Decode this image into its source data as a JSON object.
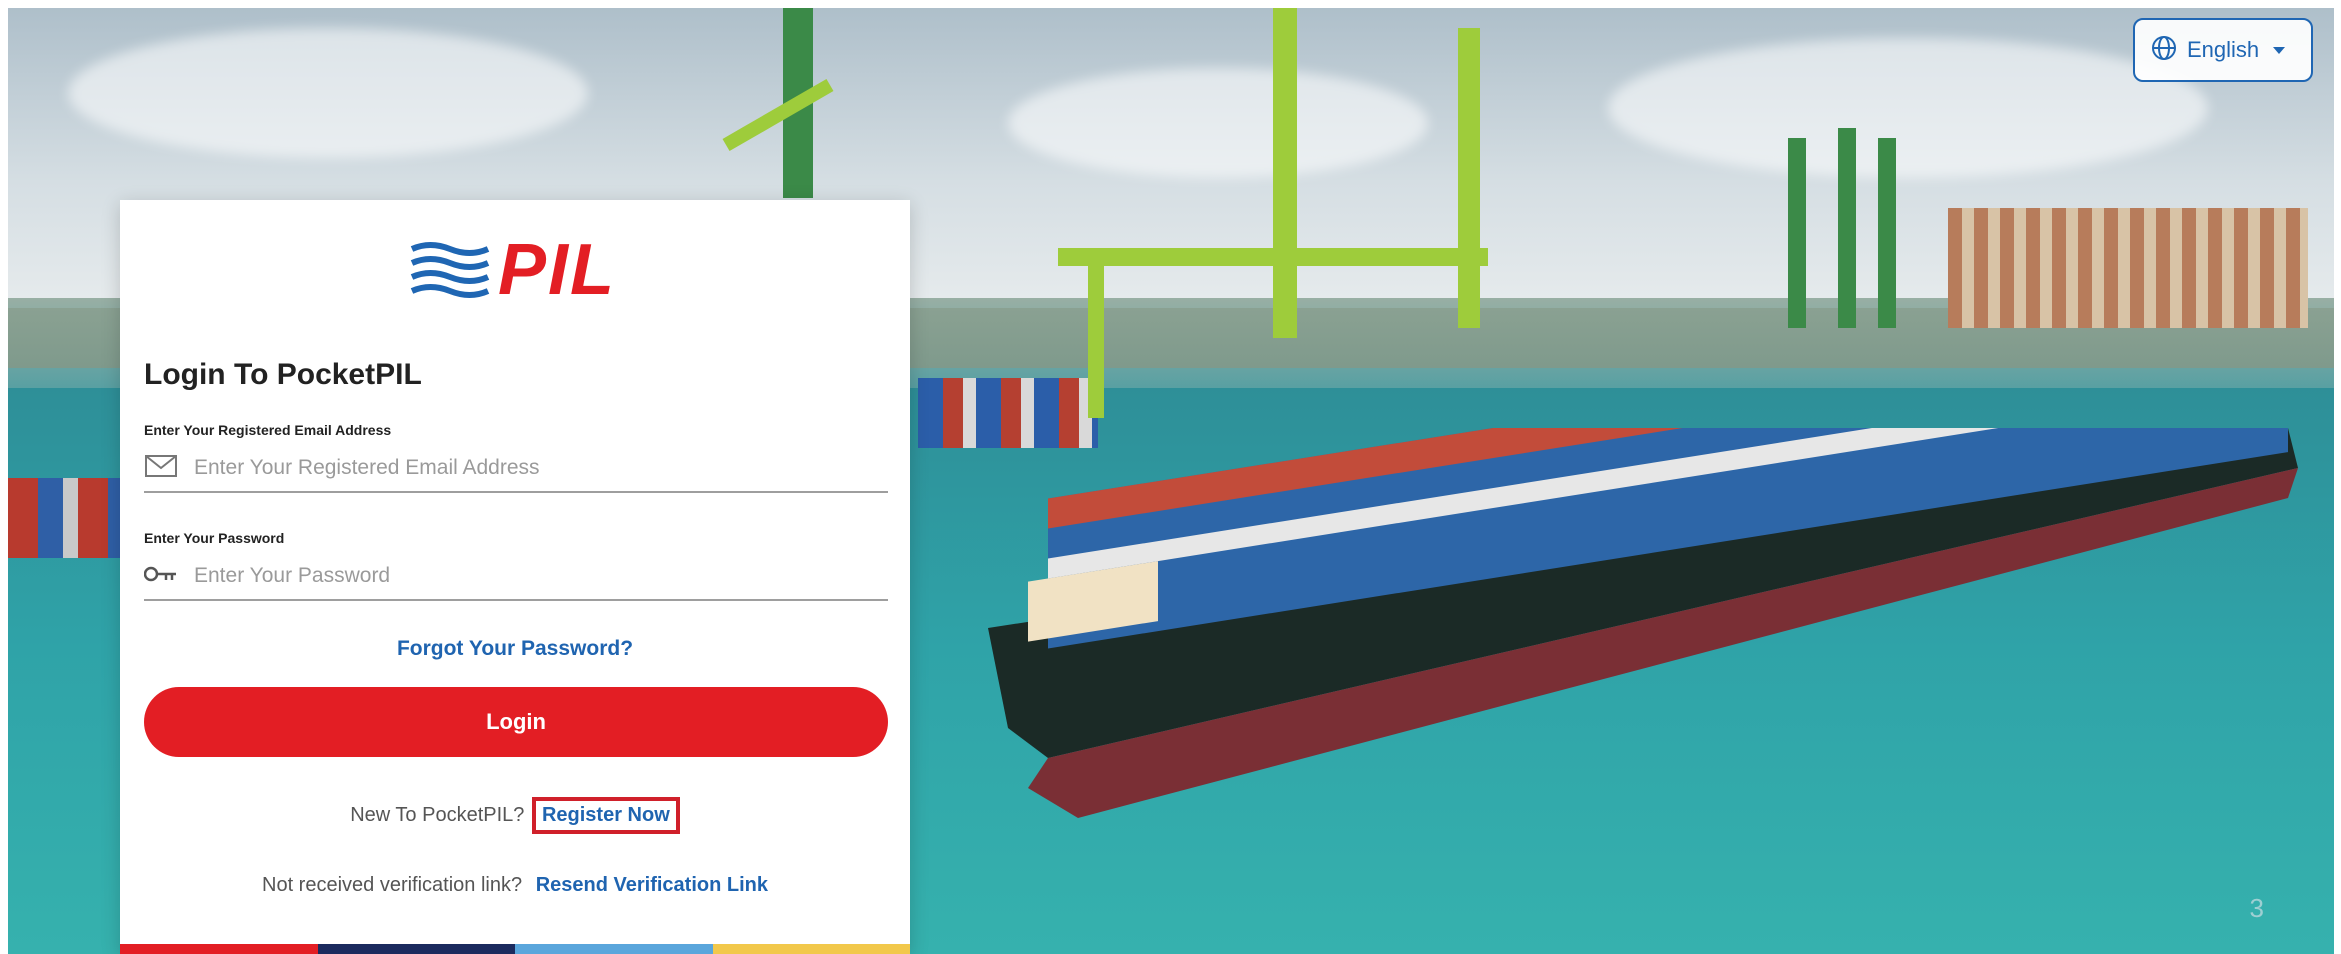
{
  "language_selector": {
    "label": "English",
    "icon": "globe-icon"
  },
  "card": {
    "logo_text": "PIL",
    "title": "Login To PocketPIL",
    "email": {
      "label": "Enter Your Registered Email Address",
      "placeholder": "Enter Your Registered Email Address",
      "value": "",
      "icon": "mail-icon"
    },
    "password": {
      "label": "Enter Your Password",
      "placeholder": "Enter Your Password",
      "value": "",
      "icon": "key-icon"
    },
    "forgot_password": "Forgot Your Password?",
    "login_button": "Login",
    "new_user_text": "New To PocketPIL?",
    "register_link": "Register Now",
    "verification_text": "Not received verification link?",
    "resend_link": "Resend Verification Link"
  },
  "colors": {
    "brand_red": "#e31e24",
    "link_blue": "#1f64b0",
    "highlight_box": "#d0202a",
    "strip": [
      "#e31e24",
      "#1b2a5e",
      "#5aa6dc",
      "#f2c84b"
    ]
  },
  "page_number": "3"
}
